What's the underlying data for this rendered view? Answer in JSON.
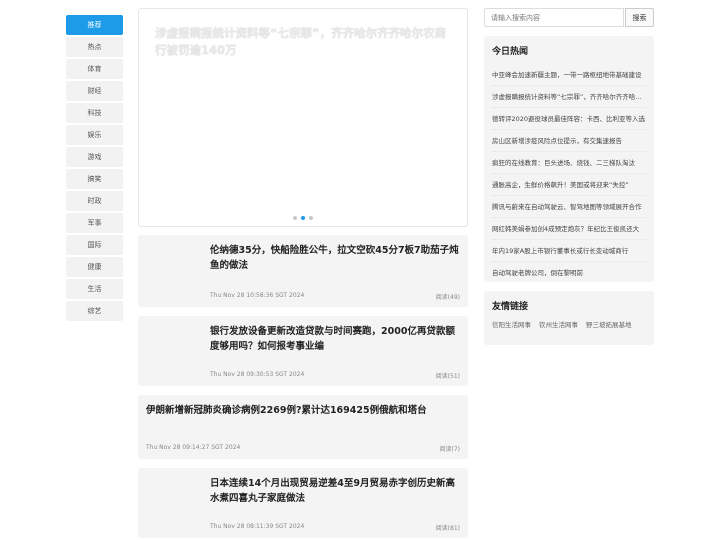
{
  "nav": {
    "items": [
      "推荐",
      "热点",
      "体育",
      "财经",
      "科技",
      "娱乐",
      "游戏",
      "搞笑",
      "时政",
      "军事",
      "国际",
      "健康",
      "生活",
      "综艺"
    ],
    "active_index": 0
  },
  "carousel": {
    "title": "涉虚报瞒报统计资料等“七宗罪”，齐齐哈尔齐齐哈尔农商行被罚逾140万",
    "slides": 3,
    "active_slide": 1
  },
  "articles": [
    {
      "title": "伦纳德35分，快船险胜公牛，拉文空砍45分7板7助茄子炖鱼的做法",
      "time": "Thu Nov 28 10:58:36 SGT 2024",
      "reads": "阅读(49)",
      "thumb": true
    },
    {
      "title": "银行发放设备更新改造贷款与时间赛跑，2000亿再贷款额度够用吗？如何报考事业编",
      "time": "Thu Nov 28 09:30:53 SGT 2024",
      "reads": "阅读(51)",
      "thumb": true
    },
    {
      "title": "伊朗新增新冠肺炎确诊病例2269例?累计达169425例俄航和塔台",
      "time": "Thu Nov 28 09:14:27 SGT 2024",
      "reads": "阅读(7)",
      "thumb": false
    },
    {
      "title": "日本连续14个月出现贸易逆差4至9月贸易赤字创历史新高水煮四喜丸子家庭做法",
      "time": "Thu Nov 28 08:11:39 SGT 2024",
      "reads": "阅读(81)",
      "thumb": true
    }
  ],
  "search": {
    "placeholder": "请输入搜索内容",
    "button_label": "搜索"
  },
  "hot": {
    "title": "今日热闻",
    "items": [
      "中亚峰会加速新疆主题，一带一路枢纽地带基础建设",
      "涉虚报瞒报统计资料等“七宗罪”，齐齐哈尔齐齐哈尔农商行",
      "德转评2020避役球员最佳阵容：卡西、比利亚等入选",
      "房山区新增涉疫风险点位提示，有交集速报告",
      "疯狂的在线教育：巨头进场、烧钱、二三梯队淘汰",
      "通胀高企，生鲜价格飙升！美国或将迎来“失控”",
      "腾讯与蔚来在自动驾驶云、智驾地图等领域展开合作",
      "网红韩美娟参加创4成预定炮灰？年纪比王俊凯还大",
      "年内19家A股上市银行董事长或行长变动城商行",
      "自动驾驶老牌公司，倒在黎明前"
    ]
  },
  "links": {
    "title": "友情链接",
    "items": [
      "信阳生活网事",
      "钦州生活网事",
      "野三坡拓展基地"
    ]
  }
}
